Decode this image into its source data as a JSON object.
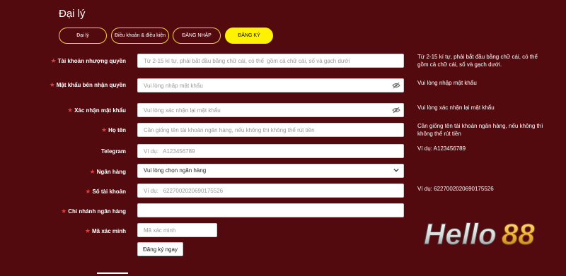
{
  "page": {
    "title": "Đại lý"
  },
  "tabs": [
    {
      "label": "Đại lý"
    },
    {
      "label": "Điều khoản & điều kiện"
    },
    {
      "label": "ĐĂNG NHẬP"
    },
    {
      "label": "ĐĂNG KÝ"
    }
  ],
  "form": {
    "username": {
      "label": "Tài khoản nhượng quyền",
      "placeholder": "Từ 2-15 kí tự, phải bắt đầu bằng chữ cái, có thể  gồm cả chữ cái, số và gạch dưới",
      "hint": "Từ 2-15 kí tự, phải bắt đầu bằng chữ cái, có thể gồm cả chữ cái, số và gạch dưới."
    },
    "password": {
      "label": "Mật khẩu bên nhận quyền",
      "placeholder": "Vui lòng nhập mật khẩu",
      "hint": "Vui lòng nhập mật khẩu"
    },
    "confirm": {
      "label": "Xác nhận mật khẩu",
      "placeholder": "Vui lòng xác nhận lại mật khẩu",
      "hint": "Vui lòng xác nhận lại mật khẩu"
    },
    "fullname": {
      "label": "Họ tên",
      "placeholder": "Cần giống tên tài khoản ngân hàng, nếu không thì không thể rút tiền",
      "hint": "Cần giống tên tài khoản ngân hàng, nếu không thì không thể rút tiền"
    },
    "telegram": {
      "label": "Telegram",
      "placeholder": "Ví dụ:   A123456789",
      "hint": "Ví dụ:     A123456789"
    },
    "bank": {
      "label": "Ngân hàng",
      "value": "Vui lòng chọn ngân hàng"
    },
    "account": {
      "label": "Số tài khoản",
      "placeholder": "Ví dụ:   6227002020690175526",
      "hint": "Ví dụ:   6227002020690175526"
    },
    "branch": {
      "label": "Chi nhánh ngân hàng",
      "placeholder": ""
    },
    "captcha": {
      "label": "Mã xác minh",
      "placeholder": "Mã xác minh"
    },
    "submit_label": "Đăng ký ngay"
  },
  "logo": {
    "text": "Hello88"
  },
  "colors": {
    "background": "#520a0e",
    "accent": "#fff200",
    "required_star": "#d7413f"
  }
}
